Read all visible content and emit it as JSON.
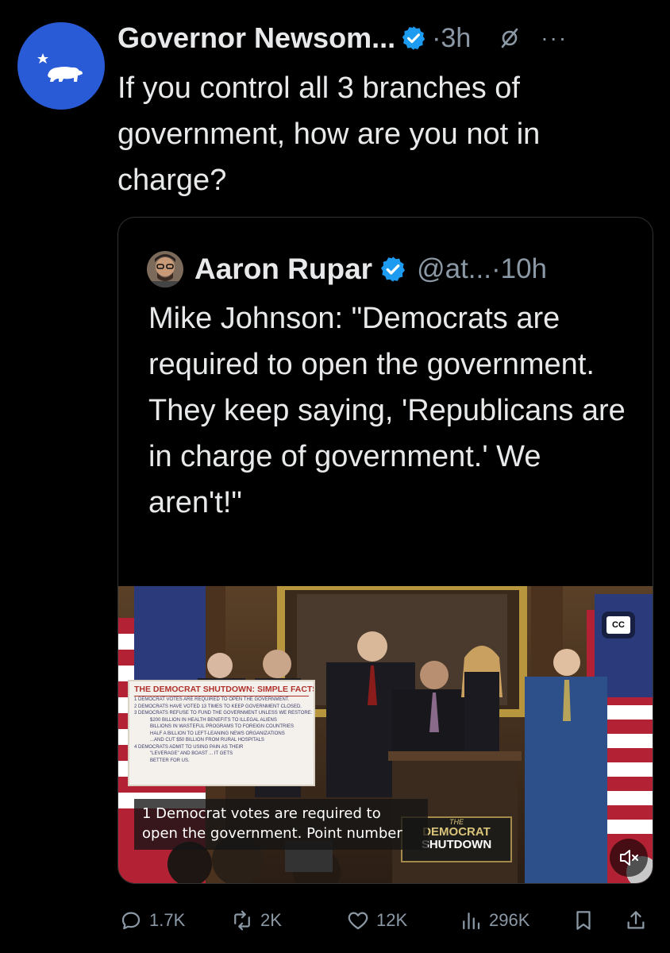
{
  "post": {
    "author_name": "Governor Newsom...",
    "time": "·3h",
    "more_label": "···",
    "text": "If you control all 3 branches of government, how are you not in charge?"
  },
  "quote": {
    "author_name": "Aaron Rupar",
    "handle": "@at...·10h",
    "text": "Mike Johnson: \"Democrats are required to open the government. They keep saying, 'Republicans are in charge of government.' We aren't!\""
  },
  "video": {
    "cc_label": "CC",
    "caption": "1 Democrat votes are required to open the government. Point number",
    "poster_title": "THE DEMOCRAT SHUTDOWN: SIMPLE FACTS",
    "poster_lines": [
      "1 DEMOCRAT VOTES ARE REQUIRED TO OPEN THE GOVERNMENT.",
      "2 DEMOCRATS HAVE VOTED 13 TIMES TO KEEP GOVERNMENT CLOSED.",
      "3 DEMOCRATS REFUSE TO FUND THE GOVERNMENT UNLESS WE RESTORE:",
      "$200 BILLION IN HEALTH BENEFITS TO ILLEGAL ALIENS",
      "BILLIONS IN WASTEFUL PROGRAMS TO FOREIGN COUNTRIES",
      "HALF A BILLION TO LEFT-LEANING NEWS ORGANIZATIONS",
      "...AND CUT $50 BILLION FROM RURAL HOSPITALS",
      "4 DEMOCRATS ADMIT TO USING PAIN AS THEIR",
      "\"LEVERAGE\" AND BOAST ... IT GETS",
      "BETTER FOR US."
    ],
    "sign_the": "THE",
    "sign_democrat": "DEMOCRAT",
    "sign_shutdown": "SHUTDOWN"
  },
  "actions": {
    "replies": "1.7K",
    "reposts": "2K",
    "likes": "12K",
    "views": "296K"
  },
  "colors": {
    "background": "#000000",
    "text": "#e7e9ea",
    "muted": "#8b98a5",
    "verified": "#1d9bf0",
    "avatar": "#2a5bd7",
    "border": "#2f3336"
  }
}
